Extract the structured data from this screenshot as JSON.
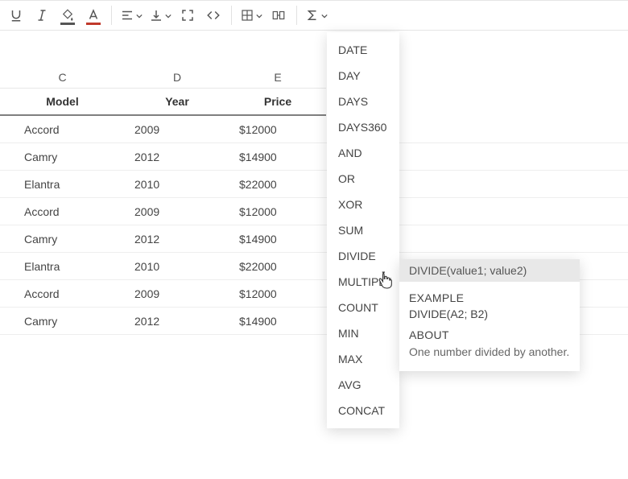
{
  "toolbar": {
    "icons": {
      "underline": "underline",
      "italic": "italic",
      "fill": "fill-color",
      "textcolor": "text-color",
      "align": "align",
      "valign": "vertical-align",
      "expand": "expand",
      "code": "code",
      "table": "table",
      "split": "split-cell",
      "formula": "formula"
    }
  },
  "columns": [
    {
      "letter": "C",
      "header": "Model"
    },
    {
      "letter": "D",
      "header": "Year"
    },
    {
      "letter": "E",
      "header": "Price"
    }
  ],
  "rows": [
    {
      "model": "Accord",
      "year": "2009",
      "price": "$12000"
    },
    {
      "model": "Camry",
      "year": "2012",
      "price": "$14900"
    },
    {
      "model": "Elantra",
      "year": "2010",
      "price": "$22000"
    },
    {
      "model": "Accord",
      "year": "2009",
      "price": "$12000"
    },
    {
      "model": "Camry",
      "year": "2012",
      "price": "$14900"
    },
    {
      "model": "Elantra",
      "year": "2010",
      "price": "$22000"
    },
    {
      "model": "Accord",
      "year": "2009",
      "price": "$12000"
    },
    {
      "model": "Camry",
      "year": "2012",
      "price": "$14900"
    }
  ],
  "menu": {
    "items": [
      "DATE",
      "DAY",
      "DAYS",
      "DAYS360",
      "AND",
      "OR",
      "XOR",
      "SUM",
      "DIVIDE",
      "MULTIPLY",
      "COUNT",
      "MIN",
      "MAX",
      "AVG",
      "CONCAT"
    ],
    "hovered_index": 8
  },
  "tooltip": {
    "signature": "DIVIDE(value1; value2)",
    "example_label": "EXAMPLE",
    "example": "DIVIDE(A2; B2)",
    "about_label": "ABOUT",
    "about": "One number divided by another."
  }
}
